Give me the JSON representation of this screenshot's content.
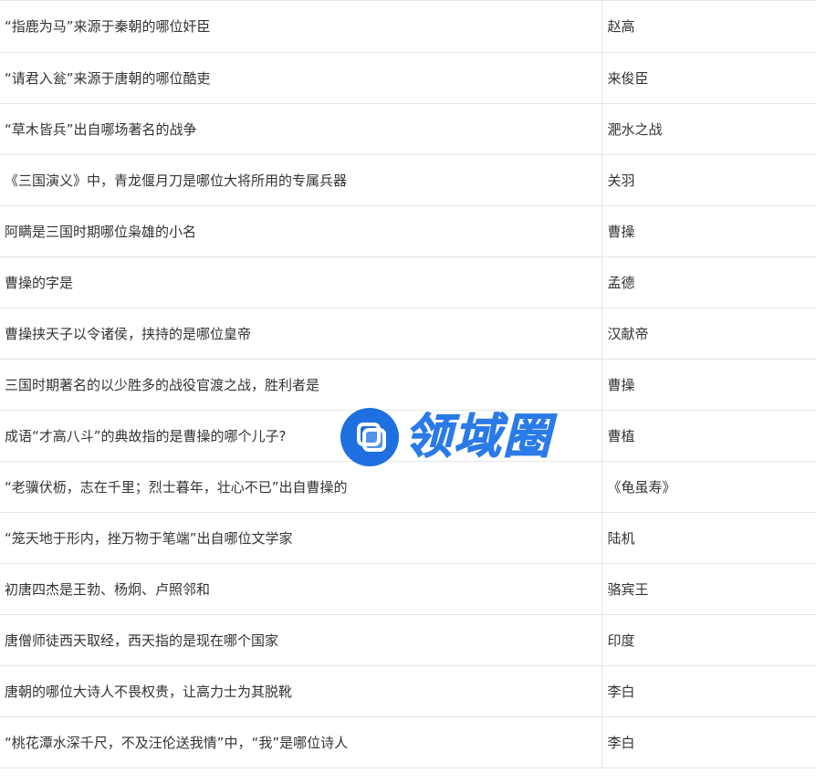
{
  "rows": [
    {
      "q": "“指鹿为马”来源于秦朝的哪位奸臣",
      "a": "赵高"
    },
    {
      "q": "“请君入瓮”来源于唐朝的哪位酷吏",
      "a": "来俊臣"
    },
    {
      "q": "“草木皆兵”出自哪场著名的战争",
      "a": "淝水之战"
    },
    {
      "q": "《三国演义》中，青龙偃月刀是哪位大将所用的专属兵器",
      "a": "关羽"
    },
    {
      "q": "阿瞒是三国时期哪位枭雄的小名",
      "a": "曹操"
    },
    {
      "q": "曹操的字是",
      "a": "孟德"
    },
    {
      "q": "曹操挟天子以令诸侯，挟持的是哪位皇帝",
      "a": "汉献帝"
    },
    {
      "q": "三国时期著名的以少胜多的战役官渡之战，胜利者是",
      "a": "曹操"
    },
    {
      "q": "成语“才高八斗”的典故指的是曹操的哪个儿子?",
      "a": "曹植"
    },
    {
      "q": "“老骥伏枥，志在千里；烈士暮年，壮心不已”出自曹操的",
      "a": "《龟虽寿》"
    },
    {
      "q": "“笼天地于形内，挫万物于笔端”出自哪位文学家",
      "a": "陆机"
    },
    {
      "q": "初唐四杰是王勃、杨炯、卢照邻和",
      "a": "骆宾王"
    },
    {
      "q": "唐僧师徒西天取经，西天指的是现在哪个国家",
      "a": "印度"
    },
    {
      "q": "唐朝的哪位大诗人不畏权贵，让高力士为其脱靴",
      "a": "李白"
    },
    {
      "q": "“桃花潭水深千尺，不及汪伦送我情”中，“我”是哪位诗人",
      "a": "李白"
    }
  ],
  "watermark": {
    "text": "领域圈",
    "icon": "overlapping-squares-icon",
    "color": "#1e6fe0"
  }
}
